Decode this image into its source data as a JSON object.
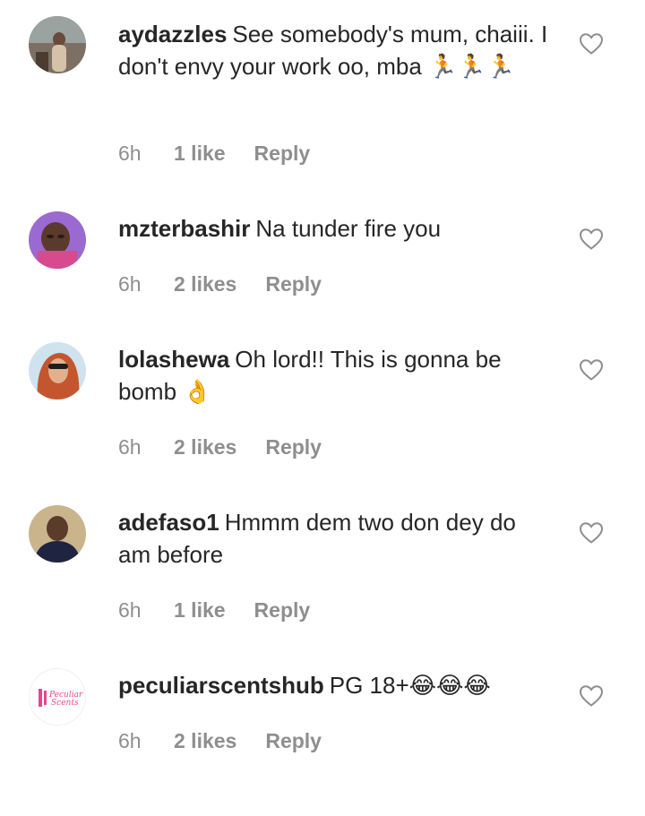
{
  "comments": [
    {
      "username": "aydazzles",
      "text": "See somebody's mum, chaiii. I don't envy your work oo, mba 🏃🏃🏃",
      "time": "6h",
      "likes": "1 like",
      "reply": "Reply",
      "avatar_color": "#6b5a4e"
    },
    {
      "username": "mzterbashir",
      "text": "Na tunder fire you",
      "time": "6h",
      "likes": "2 likes",
      "reply": "Reply",
      "avatar_color": "#8a4fb8"
    },
    {
      "username": "lolashewa",
      "text": "Oh lord!! This is gonna be bomb 👌",
      "time": "6h",
      "likes": "2 likes",
      "reply": "Reply",
      "avatar_color": "#c4562f"
    },
    {
      "username": "adefaso1",
      "text": "Hmmm dem two don dey do am before",
      "time": "6h",
      "likes": "1 like",
      "reply": "Reply",
      "avatar_color": "#2b2f45"
    },
    {
      "username": "peculiarscentshub",
      "text": "PG 18+😂😂😂",
      "time": "6h",
      "likes": "2 likes",
      "reply": "Reply",
      "avatar_color": "#e8458b",
      "avatar_logo_text": "Peculiar Scents"
    }
  ],
  "icons": {
    "like": "heart-outline-icon"
  },
  "colors": {
    "text": "#262626",
    "meta": "#8e8e8e",
    "heart_stroke": "#8e8e8e"
  }
}
